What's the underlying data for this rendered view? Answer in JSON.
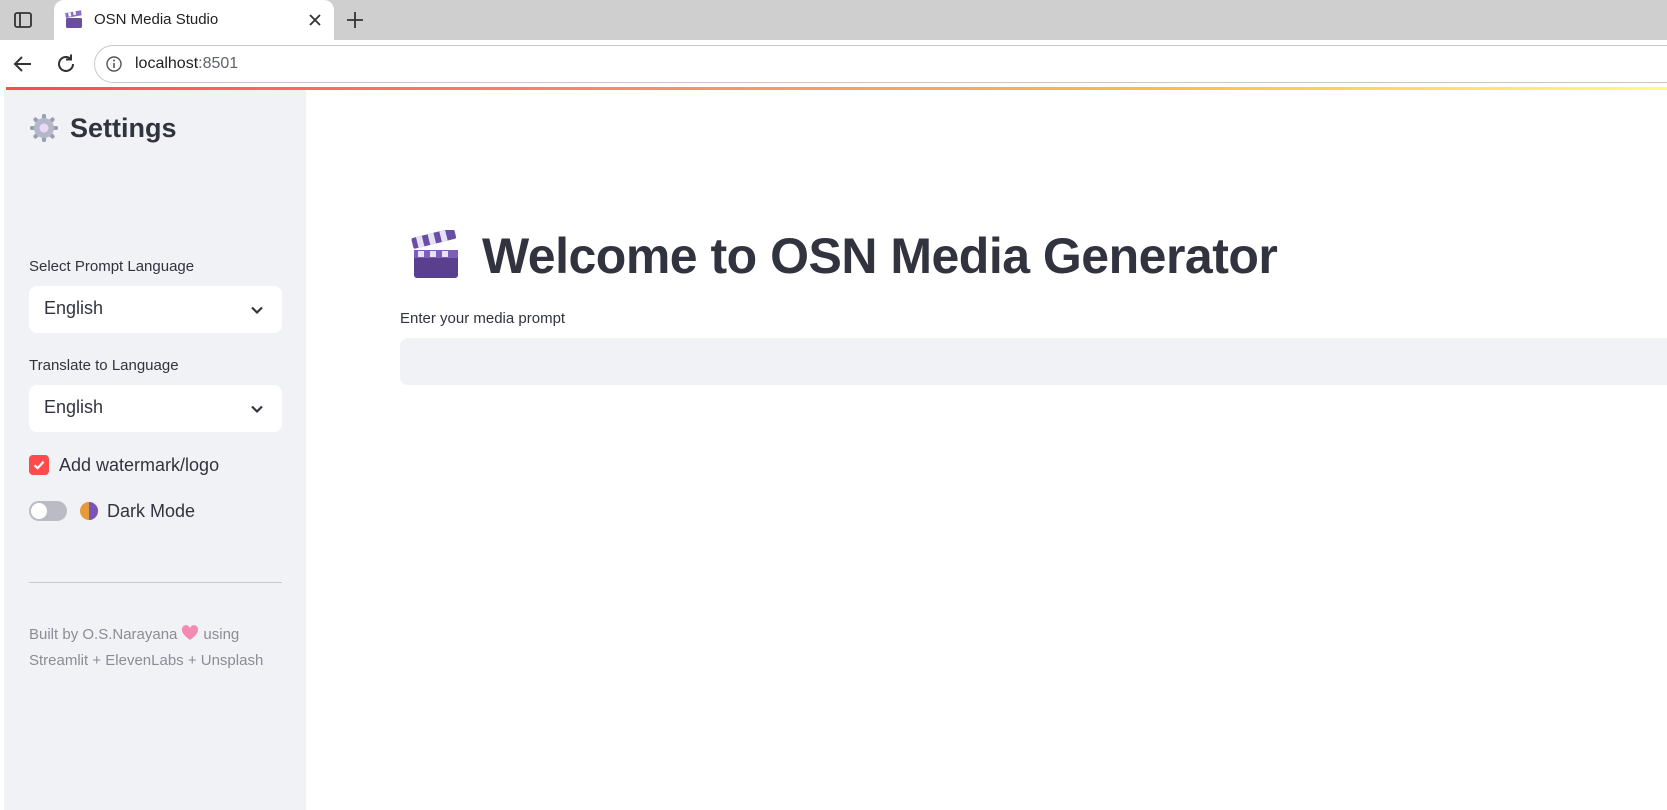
{
  "browser": {
    "tab_title": "OSN Media Studio",
    "url_host": "localhost",
    "url_port": ":8501"
  },
  "sidebar": {
    "settings_title": "Settings",
    "prompt_language": {
      "label": "Select Prompt Language",
      "value": "English"
    },
    "translate_language": {
      "label": "Translate to Language",
      "value": "English"
    },
    "watermark": {
      "label": "Add watermark/logo",
      "checked": true
    },
    "dark_mode": {
      "label": "Dark Mode",
      "on": false
    },
    "footer": {
      "line1_prefix": "Built by O.S.Narayana",
      "line1_suffix": "using",
      "line2": "Streamlit + ElevenLabs + Unsplash"
    }
  },
  "main": {
    "title": "Welcome to OSN Media Generator",
    "prompt_label": "Enter your media prompt",
    "prompt_value": ""
  },
  "colors": {
    "accent": "#ff4b4b",
    "sidebar_bg": "#f0f2f6",
    "text": "#31333f"
  }
}
